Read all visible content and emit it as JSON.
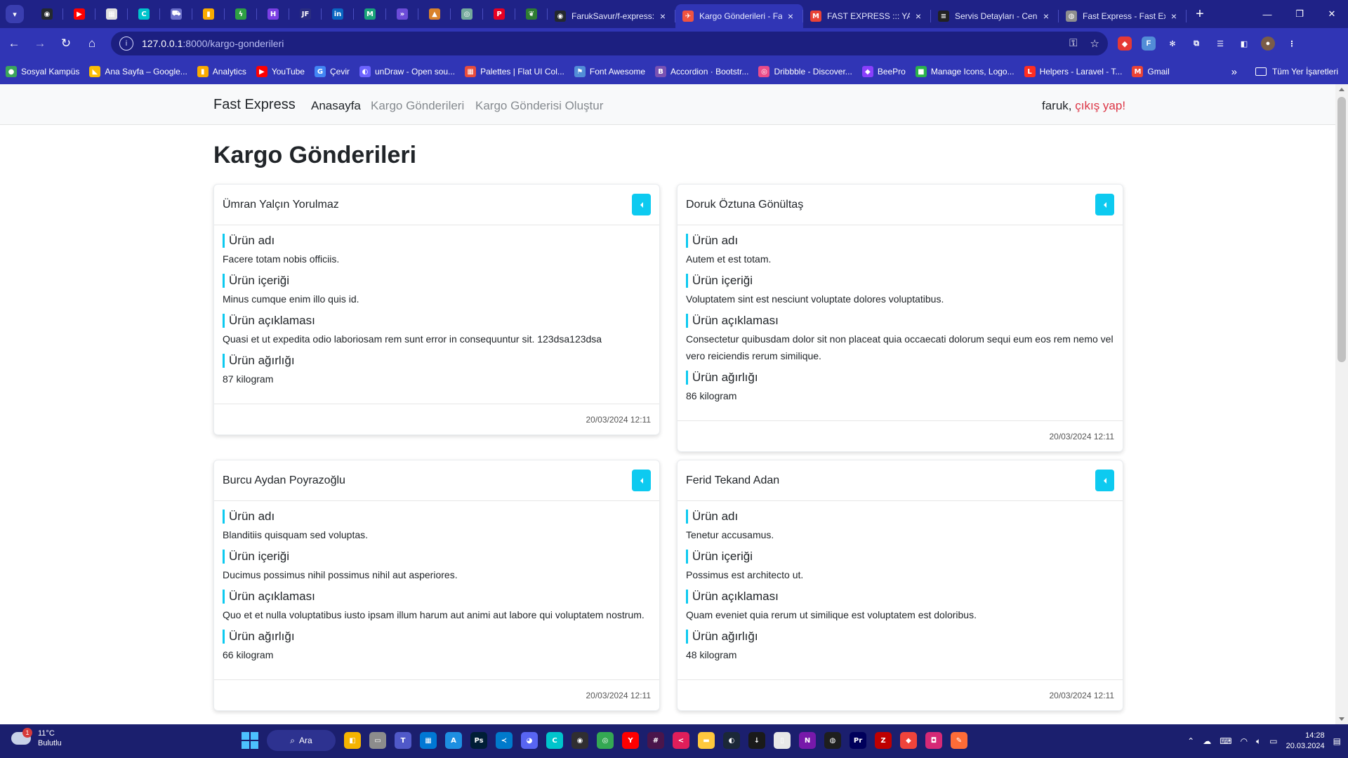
{
  "browser": {
    "pinned_tabs": [
      {
        "icon": "github-icon",
        "color": "#24292e",
        "glyph": "◉"
      },
      {
        "icon": "youtube-icon",
        "color": "#ff0000",
        "glyph": "▶"
      },
      {
        "icon": "gallery-icon",
        "color": "#e0e0e0",
        "glyph": "▦"
      },
      {
        "icon": "canva-icon",
        "color": "#00c4cc",
        "glyph": "C"
      },
      {
        "icon": "car-icon",
        "color": "#6a6fc9",
        "glyph": "⛟"
      },
      {
        "icon": "analytics-icon",
        "color": "#f9ab00",
        "glyph": "▮"
      },
      {
        "icon": "bolt-icon",
        "color": "#2ea043",
        "glyph": "ϟ"
      },
      {
        "icon": "hive-icon",
        "color": "#7b3fe4",
        "glyph": "H"
      },
      {
        "icon": "jf-icon",
        "color": "#2a2d80",
        "glyph": "JF"
      },
      {
        "icon": "linkedin-icon",
        "color": "#0a66c2",
        "glyph": "in"
      },
      {
        "icon": "mail-check-icon",
        "color": "#1aa37a",
        "glyph": "M"
      },
      {
        "icon": "forward-icon",
        "color": "#6c4cd8",
        "glyph": "»"
      },
      {
        "icon": "pyramid-icon",
        "color": "#d9822b",
        "glyph": "▲"
      },
      {
        "icon": "chatgpt-icon",
        "color": "#74aa9c",
        "glyph": "◎"
      },
      {
        "icon": "pinterest-icon",
        "color": "#e60023",
        "glyph": "P"
      },
      {
        "icon": "leaf-icon",
        "color": "#2e7d32",
        "glyph": "❦"
      }
    ],
    "tabs": [
      {
        "title": "FarukSavur/f-express:",
        "icon": "github-icon",
        "color": "#24292e",
        "glyph": "◉",
        "active": false
      },
      {
        "title": "Kargo Gönderileri - Fa",
        "icon": "app-icon",
        "color": "#f05340",
        "glyph": "✈",
        "active": true
      },
      {
        "title": "FAST EXPRESS ::: YAZI",
        "icon": "gmail-icon",
        "color": "#ea4335",
        "glyph": "M",
        "active": false
      },
      {
        "title": "Servis Detayları - Cen",
        "icon": "service-icon",
        "color": "#222",
        "glyph": "≡",
        "active": false
      },
      {
        "title": "Fast Express - Fast Ex",
        "icon": "globe-icon",
        "color": "#8e8e8e",
        "glyph": "◍",
        "active": false
      }
    ],
    "url_host": "127.0.0.1",
    "url_path": ":8000/kargo-gonderileri",
    "bookmarks": [
      {
        "label": "Sosyal Kampüs",
        "icon": "campus-icon",
        "color": "#3ba55c",
        "glyph": "●"
      },
      {
        "label": "Ana Sayfa – Google...",
        "icon": "google-ads-icon",
        "color": "#fbbc04",
        "glyph": "◣"
      },
      {
        "label": "Analytics",
        "icon": "analytics-icon",
        "color": "#f9ab00",
        "glyph": "▮"
      },
      {
        "label": "YouTube",
        "icon": "youtube-icon",
        "color": "#ff0000",
        "glyph": "▶"
      },
      {
        "label": "Çevir",
        "icon": "translate-icon",
        "color": "#4285f4",
        "glyph": "G"
      },
      {
        "label": "unDraw - Open sou...",
        "icon": "undraw-icon",
        "color": "#6c63ff",
        "glyph": "◐"
      },
      {
        "label": "Palettes | Flat UI Col...",
        "icon": "palette-icon",
        "color": "#e74c3c",
        "glyph": "▦"
      },
      {
        "label": "Font Awesome",
        "icon": "flag-icon",
        "color": "#528dd7",
        "glyph": "⚑"
      },
      {
        "label": "Accordion · Bootstr...",
        "icon": "bootstrap-icon",
        "color": "#7952b3",
        "glyph": "B"
      },
      {
        "label": "Dribbble - Discover...",
        "icon": "dribbble-icon",
        "color": "#ea4c89",
        "glyph": "◎"
      },
      {
        "label": "BeePro",
        "icon": "beepro-icon",
        "color": "#8a3ffc",
        "glyph": "◆"
      },
      {
        "label": "Manage Icons, Logo...",
        "icon": "icons-icon",
        "color": "#2bb24c",
        "glyph": "■"
      },
      {
        "label": "Helpers - Laravel - T...",
        "icon": "laravel-icon",
        "color": "#ff2d20",
        "glyph": "L"
      },
      {
        "label": "Gmail",
        "icon": "gmail-icon",
        "color": "#ea4335",
        "glyph": "M"
      }
    ],
    "bookmarks_more": "»",
    "all_bookmarks_label": "Tüm Yer İşaretleri"
  },
  "app": {
    "brand": "Fast Express",
    "nav": [
      {
        "label": "Anasayfa",
        "active": true
      },
      {
        "label": "Kargo Gönderileri",
        "active": false
      },
      {
        "label": "Kargo Gönderisi Oluştur",
        "active": false
      }
    ],
    "user_name": "faruk, ",
    "logout_label": "çıkış yap!",
    "page_title": "Kargo Gönderileri",
    "field_labels": {
      "name": "Ürün adı",
      "content": "Ürün içeriği",
      "description": "Ürün açıklaması",
      "weight": "Ürün ağırlığı"
    },
    "shipments": [
      {
        "sender": "Ümran Yalçın Yorulmaz",
        "name": "Facere totam nobis officiis.",
        "content": "Minus cumque enim illo quis id.",
        "description": "Quasi et ut expedita odio laboriosam rem sunt error in consequuntur sit. 123dsa123dsa",
        "weight": "87 kilogram",
        "date": "20/03/2024 12:11"
      },
      {
        "sender": "Doruk Öztuna Gönültaş",
        "name": "Autem et est totam.",
        "content": "Voluptatem sint est nesciunt voluptate dolores voluptatibus.",
        "description": "Consectetur quibusdam dolor sit non placeat quia occaecati dolorum sequi eum eos rem nemo vel vero reiciendis rerum similique.",
        "weight": "86 kilogram",
        "date": "20/03/2024 12:11"
      },
      {
        "sender": "Burcu Aydan Poyrazoğlu",
        "name": "Blanditiis quisquam sed voluptas.",
        "content": "Ducimus possimus nihil possimus nihil aut asperiores.",
        "description": "Quo et et nulla voluptatibus iusto ipsam illum harum aut animi aut labore qui voluptatem nostrum.",
        "weight": "66 kilogram",
        "date": "20/03/2024 12:11"
      },
      {
        "sender": "Ferid Tekand Adan",
        "name": "Tenetur accusamus.",
        "content": "Possimus est architecto ut.",
        "description": "Quam eveniet quia rerum ut similique est voluptatem est doloribus.",
        "weight": "48 kilogram",
        "date": "20/03/2024 12:11"
      }
    ],
    "accent_color": "#0dcaf0",
    "danger_color": "#dc3545"
  },
  "taskbar": {
    "weather_temp": "11°C",
    "weather_desc": "Bulutlu",
    "weather_badge": "1",
    "search_label": "Ara",
    "apps": [
      {
        "icon": "widgets-icon",
        "color": "#f5b400",
        "glyph": "◧"
      },
      {
        "icon": "file-explorer-icon",
        "color": "#8c8c8c",
        "glyph": "▭"
      },
      {
        "icon": "teams-icon",
        "color": "#5059c9",
        "glyph": "T"
      },
      {
        "icon": "store-icon",
        "color": "#0078d4",
        "glyph": "▦"
      },
      {
        "icon": "app-store-icon",
        "color": "#1d8fe1",
        "glyph": "A"
      },
      {
        "icon": "photoshop-icon",
        "color": "#001e36",
        "glyph": "Ps"
      },
      {
        "icon": "vscode-icon",
        "color": "#007acc",
        "glyph": "≺"
      },
      {
        "icon": "discord-icon",
        "color": "#5865f2",
        "glyph": "◕"
      },
      {
        "icon": "canva-icon",
        "color": "#00c4cc",
        "glyph": "C"
      },
      {
        "icon": "obs-icon",
        "color": "#302e31",
        "glyph": "◉"
      },
      {
        "icon": "chrome-icon",
        "color": "#34a853",
        "glyph": "◎"
      },
      {
        "icon": "yandex-icon",
        "color": "#ff0000",
        "glyph": "Y"
      },
      {
        "icon": "slack-icon",
        "color": "#4a154b",
        "glyph": "#"
      },
      {
        "icon": "share-icon",
        "color": "#e01e5a",
        "glyph": "<"
      },
      {
        "icon": "folder-icon",
        "color": "#ffc83d",
        "glyph": "▬"
      },
      {
        "icon": "steam-icon",
        "color": "#1b2838",
        "glyph": "◐"
      },
      {
        "icon": "download-icon",
        "color": "#1a1a1a",
        "glyph": "↓"
      },
      {
        "icon": "notepad-icon",
        "color": "#e8e8e8",
        "glyph": "▯"
      },
      {
        "icon": "onenote-icon",
        "color": "#7719aa",
        "glyph": "N"
      },
      {
        "icon": "figma-icon",
        "color": "#1e1e1e",
        "glyph": "◍"
      },
      {
        "icon": "premiere-icon",
        "color": "#00005b",
        "glyph": "Pr"
      },
      {
        "icon": "filezilla-icon",
        "color": "#bf0000",
        "glyph": "Z"
      },
      {
        "icon": "anydesk-icon",
        "color": "#ef443b",
        "glyph": "◆"
      },
      {
        "icon": "instagram-icon",
        "color": "#d62976",
        "glyph": "◘"
      },
      {
        "icon": "postman-icon",
        "color": "#ff6c37",
        "glyph": "✎"
      }
    ],
    "time": "14:28",
    "date": "20.03.2024"
  }
}
